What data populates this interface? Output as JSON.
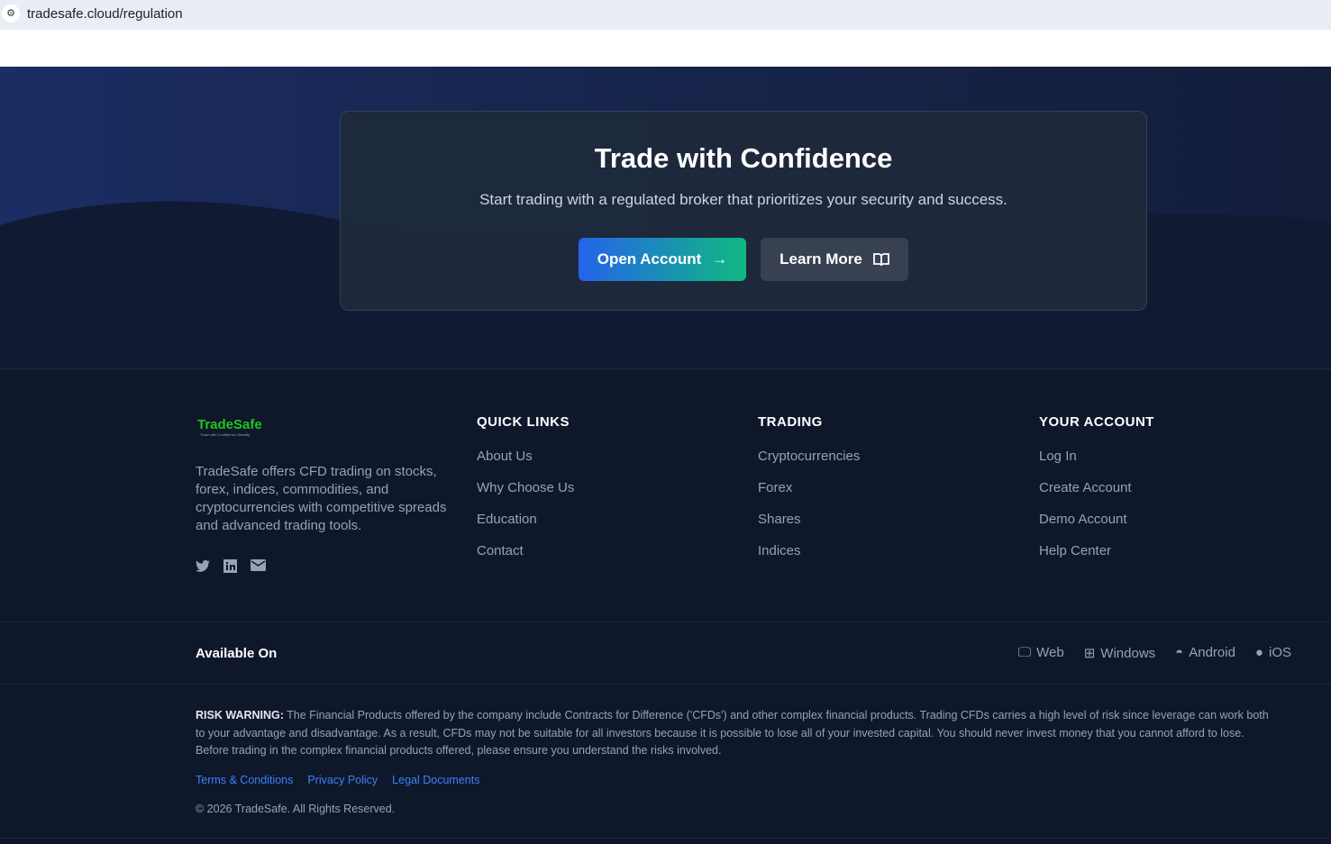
{
  "browser": {
    "url": "tradesafe.cloud/regulation"
  },
  "cta": {
    "title": "Trade with Confidence",
    "subtitle": "Start trading with a regulated broker that prioritizes your security and success.",
    "open_account": "Open Account",
    "learn_more": "Learn More"
  },
  "brand": {
    "name": "TradeSafe",
    "tagline": "Trade with Confidence Globally",
    "description": "TradeSafe offers CFD trading on stocks, forex, indices, commodities, and cryptocurrencies with competitive spreads and advanced trading tools."
  },
  "columns": [
    {
      "title": "QUICK LINKS",
      "links": [
        "About Us",
        "Why Choose Us",
        "Education",
        "Contact"
      ]
    },
    {
      "title": "TRADING",
      "links": [
        "Cryptocurrencies",
        "Forex",
        "Shares",
        "Indices"
      ]
    },
    {
      "title": "YOUR ACCOUNT",
      "links": [
        "Log In",
        "Create Account",
        "Demo Account",
        "Help Center"
      ]
    }
  ],
  "available": {
    "label": "Available On",
    "platforms": [
      "Web",
      "Windows",
      "Android",
      "iOS"
    ]
  },
  "risk": {
    "label": "RISK WARNING:",
    "text": " The Financial Products offered by the company include Contracts for Difference ('CFDs') and other complex financial products. Trading CFDs carries a high level of risk since leverage can work both to your advantage and disadvantage. As a result, CFDs may not be suitable for all investors because it is possible to lose all of your invested capital. You should never invest money that you cannot afford to lose. Before trading in the complex financial products offered, please ensure you understand the risks involved."
  },
  "legal": [
    "Terms & Conditions",
    "Privacy Policy",
    "Legal Documents"
  ],
  "copyright": "© 2026 TradeSafe. All Rights Reserved."
}
